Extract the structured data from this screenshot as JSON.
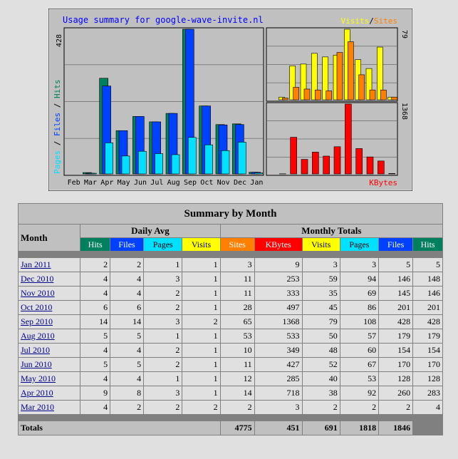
{
  "chart_data": {
    "type": "bar",
    "title": "Usage summary for google-wave-invite.nl",
    "categories": [
      "Feb",
      "Mar",
      "Apr",
      "May",
      "Jun",
      "Jul",
      "Aug",
      "Sep",
      "Oct",
      "Nov",
      "Dec",
      "Jan"
    ],
    "left_panel": {
      "ylabel_parts": [
        "Pages",
        "Files",
        "Hits"
      ],
      "ymax_label": "428",
      "ymax": 428,
      "series": [
        {
          "name": "Hits",
          "color": "#00805c",
          "values": [
            0,
            4,
            283,
            128,
            170,
            154,
            179,
            428,
            201,
            146,
            148,
            5
          ]
        },
        {
          "name": "Files",
          "color": "#0040ff",
          "values": [
            0,
            2,
            260,
            128,
            170,
            154,
            179,
            428,
            201,
            145,
            146,
            5
          ]
        },
        {
          "name": "Pages",
          "color": "#00e0ff",
          "values": [
            0,
            2,
            92,
            53,
            67,
            60,
            57,
            108,
            86,
            69,
            94,
            3
          ]
        }
      ]
    },
    "top_right_panel": {
      "legend_parts": [
        "Visits",
        "/",
        "Sites"
      ],
      "ymax_label": "79",
      "ymax": 79,
      "series": [
        {
          "name": "Visits",
          "color": "#ffff00",
          "values": [
            0,
            3,
            38,
            40,
            52,
            48,
            50,
            79,
            45,
            35,
            59,
            3
          ]
        },
        {
          "name": "Sites",
          "color": "#ff8000",
          "values": [
            0,
            2,
            14,
            12,
            11,
            10,
            53,
            65,
            28,
            11,
            11,
            3
          ]
        }
      ]
    },
    "bottom_right_panel": {
      "legend": "KBytes",
      "ymax_label": "1368",
      "ymax": 1368,
      "series": [
        {
          "name": "KBytes",
          "color": "#ff0000",
          "values": [
            0,
            3,
            718,
            285,
            427,
            349,
            533,
            1368,
            497,
            333,
            253,
            9
          ]
        }
      ]
    }
  },
  "table": {
    "title": "Summary by Month",
    "month_header": "Month",
    "daily_avg_header": "Daily Avg",
    "monthly_totals_header": "Monthly Totals",
    "daily_cols": [
      "Hits",
      "Files",
      "Pages",
      "Visits"
    ],
    "monthly_cols": [
      "Sites",
      "KBytes",
      "Visits",
      "Pages",
      "Files",
      "Hits"
    ],
    "rows": [
      {
        "month": "Jan 2011",
        "values": [
          2,
          2,
          1,
          1,
          3,
          9,
          3,
          3,
          5,
          5
        ]
      },
      {
        "month": "Dec 2010",
        "values": [
          4,
          4,
          3,
          1,
          11,
          253,
          59,
          94,
          146,
          148
        ]
      },
      {
        "month": "Nov 2010",
        "values": [
          4,
          4,
          2,
          1,
          11,
          333,
          35,
          69,
          145,
          146
        ]
      },
      {
        "month": "Oct 2010",
        "values": [
          6,
          6,
          2,
          1,
          28,
          497,
          45,
          86,
          201,
          201
        ]
      },
      {
        "month": "Sep 2010",
        "values": [
          14,
          14,
          3,
          2,
          65,
          1368,
          79,
          108,
          428,
          428
        ]
      },
      {
        "month": "Aug 2010",
        "values": [
          5,
          5,
          1,
          1,
          53,
          533,
          50,
          57,
          179,
          179
        ]
      },
      {
        "month": "Jul 2010",
        "values": [
          4,
          4,
          2,
          1,
          10,
          349,
          48,
          60,
          154,
          154
        ]
      },
      {
        "month": "Jun 2010",
        "values": [
          5,
          5,
          2,
          1,
          11,
          427,
          52,
          67,
          170,
          170
        ]
      },
      {
        "month": "May 2010",
        "values": [
          4,
          4,
          1,
          1,
          12,
          285,
          40,
          53,
          128,
          128
        ]
      },
      {
        "month": "Apr 2010",
        "values": [
          9,
          8,
          3,
          1,
          14,
          718,
          38,
          92,
          260,
          283
        ]
      },
      {
        "month": "Mar 2010",
        "values": [
          4,
          2,
          2,
          2,
          2,
          3,
          2,
          2,
          2,
          4
        ]
      }
    ],
    "totals_label": "Totals",
    "totals": [
      "4775",
      "451",
      "691",
      "1818",
      "1846"
    ]
  }
}
